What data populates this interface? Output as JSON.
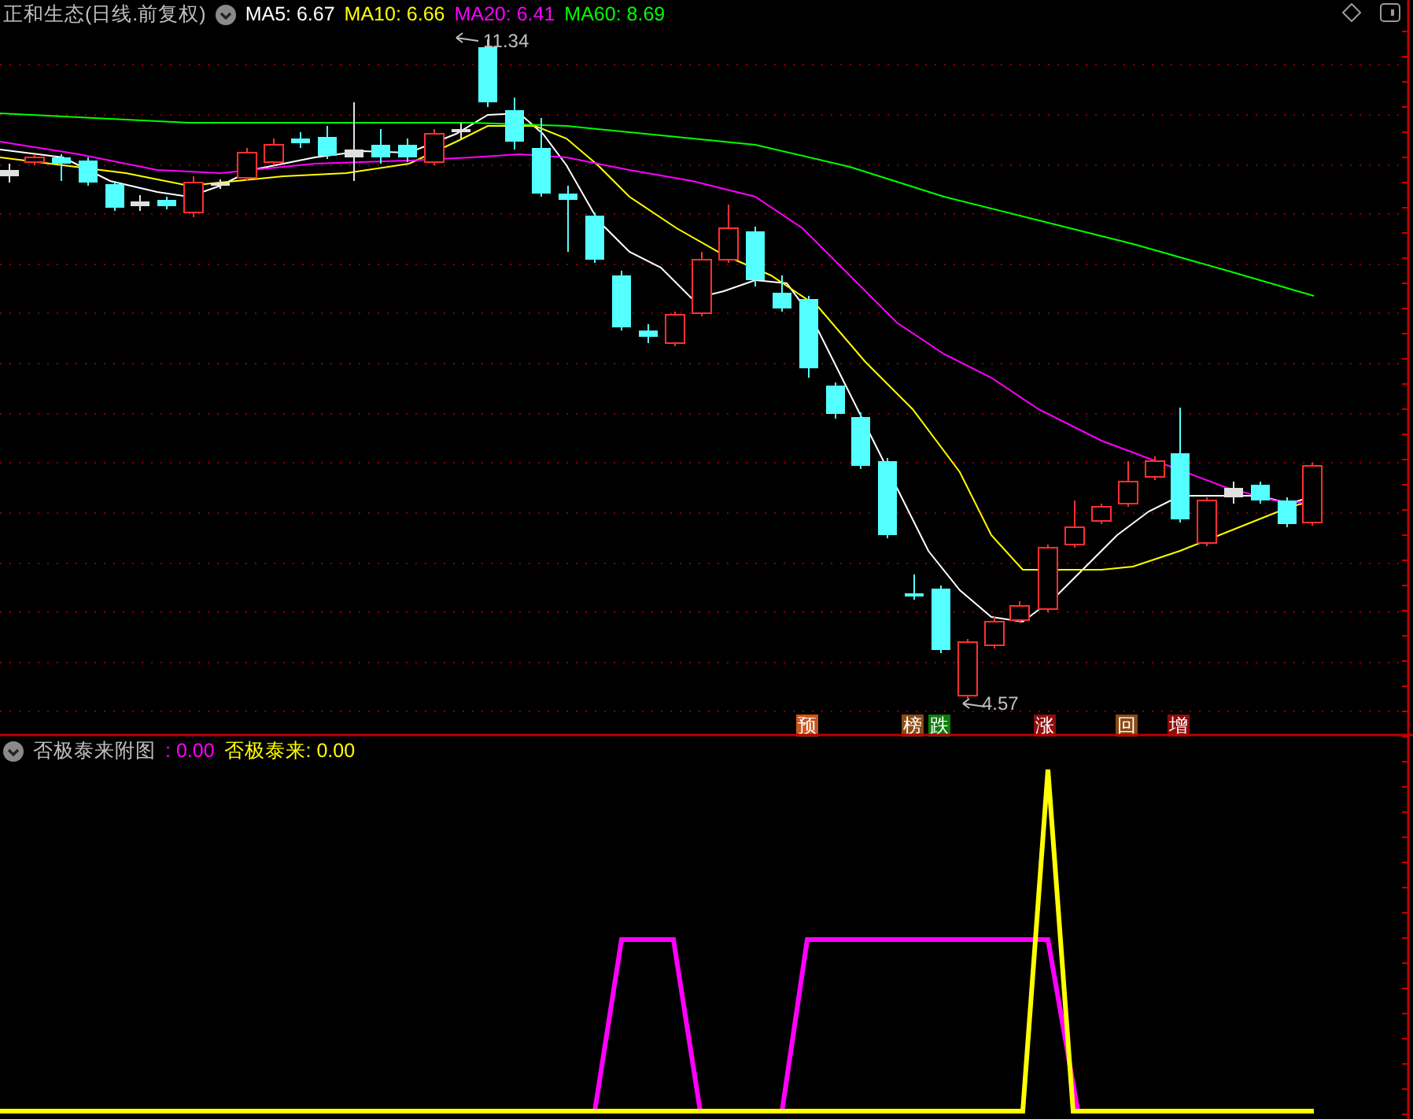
{
  "header": {
    "title": "正和生态(日线.前复权)",
    "indicators": [
      {
        "text": "MA5: 6.67",
        "color": "#ffffff"
      },
      {
        "text": "MA10: 6.66",
        "color": "#ffff00"
      },
      {
        "text": "MA20: 6.41",
        "color": "#ff00ff"
      },
      {
        "text": "MA60: 8.69",
        "color": "#00ff00"
      }
    ]
  },
  "price_labels": [
    {
      "text": "11.34"
    },
    {
      "text": "4.57"
    }
  ],
  "signal_tags": [
    {
      "label": "预",
      "color": "#c8561a"
    },
    {
      "label": "榜",
      "color": "#8b4a14"
    },
    {
      "label": "跌",
      "color": "#0c7c0c"
    },
    {
      "label": "涨",
      "color": "#8c0c0c"
    },
    {
      "label": "回",
      "color": "#8b4a14"
    },
    {
      "label": "增",
      "color": "#8c0c0c"
    }
  ],
  "sub_panel": {
    "title": "否极泰来附图",
    "indicators": [
      {
        "text": ": 0.00",
        "color": "#ff00ff"
      },
      {
        "text": "否极泰来: 0.00",
        "color": "#ffff00"
      }
    ]
  }
}
